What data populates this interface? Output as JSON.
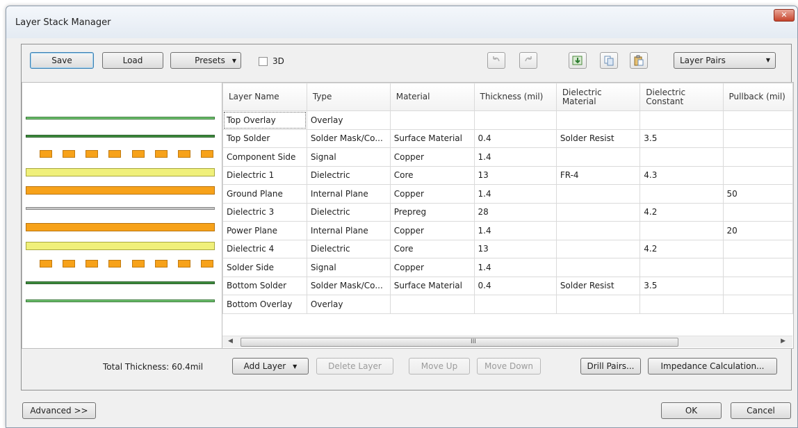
{
  "window": {
    "title": "Layer Stack Manager",
    "close_glyph": "✕"
  },
  "toolbar": {
    "save": "Save",
    "load": "Load",
    "presets": "Presets",
    "checkbox_3d": "3D",
    "view_select": "Layer Pairs",
    "icons": [
      "undo-icon",
      "redo-icon",
      "import-icon",
      "copy-icon",
      "paste-icon"
    ]
  },
  "preview": {
    "colors": {
      "overlay": "#6ec36e",
      "solder": "#3f8f3f",
      "copper_pad": "#f7a21a",
      "core": "#f0f07a",
      "plane": "#f7a21a",
      "prepreg": "#c8c8c8"
    }
  },
  "grid": {
    "columns": [
      "Layer Name",
      "Type",
      "Material",
      "Thickness (mil)",
      "Dielectric Material",
      "Dielectric Constant",
      "Pullback (mil)"
    ],
    "rows": [
      [
        "Top Overlay",
        "Overlay",
        "",
        "",
        "",
        "",
        ""
      ],
      [
        "Top Solder",
        "Solder Mask/Co...",
        "Surface Material",
        "0.4",
        "Solder Resist",
        "3.5",
        ""
      ],
      [
        "Component Side",
        "Signal",
        "Copper",
        "1.4",
        "",
        "",
        ""
      ],
      [
        "Dielectric 1",
        "Dielectric",
        "Core",
        "13",
        "FR-4",
        "4.3",
        ""
      ],
      [
        "Ground Plane",
        "Internal Plane",
        "Copper",
        "1.4",
        "",
        "",
        "50"
      ],
      [
        "Dielectric 3",
        "Dielectric",
        "Prepreg",
        "28",
        "",
        "4.2",
        ""
      ],
      [
        "Power Plane",
        "Internal Plane",
        "Copper",
        "1.4",
        "",
        "",
        "20"
      ],
      [
        "Dielectric 4",
        "Dielectric",
        "Core",
        "13",
        "",
        "4.2",
        ""
      ],
      [
        "Solder Side",
        "Signal",
        "Copper",
        "1.4",
        "",
        "",
        ""
      ],
      [
        "Bottom Solder",
        "Solder Mask/Co...",
        "Surface Material",
        "0.4",
        "Solder Resist",
        "3.5",
        ""
      ],
      [
        "Bottom Overlay",
        "Overlay",
        "",
        "",
        "",
        "",
        ""
      ]
    ],
    "scroll_grip": "III"
  },
  "footer": {
    "total_thickness": "Total Thickness: 60.4mil",
    "add_layer": "Add Layer",
    "delete_layer": "Delete Layer",
    "move_up": "Move Up",
    "move_down": "Move Down",
    "drill_pairs": "Drill Pairs...",
    "impedance": "Impedance Calculation..."
  },
  "dialog": {
    "advanced": "Advanced >>",
    "ok": "OK",
    "cancel": "Cancel"
  }
}
